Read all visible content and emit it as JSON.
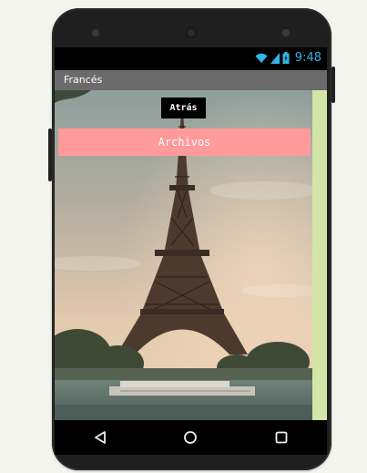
{
  "status_bar": {
    "time": "9:48",
    "icons": [
      "wifi-icon",
      "signal-icon",
      "battery-charging-icon"
    ],
    "accent_color": "#33b5e5"
  },
  "title_bar": {
    "title": "Francés"
  },
  "screen": {
    "back_button_label": "Atrás",
    "files_banner_label": "Archivos",
    "background_image": "eiffel-tower-photo",
    "banner_color": "#ff9a9a",
    "side_panel_color": "#d3e6a7"
  },
  "nav_bar": {
    "buttons": [
      "back-triangle-icon",
      "home-circle-icon",
      "recents-square-icon"
    ]
  }
}
